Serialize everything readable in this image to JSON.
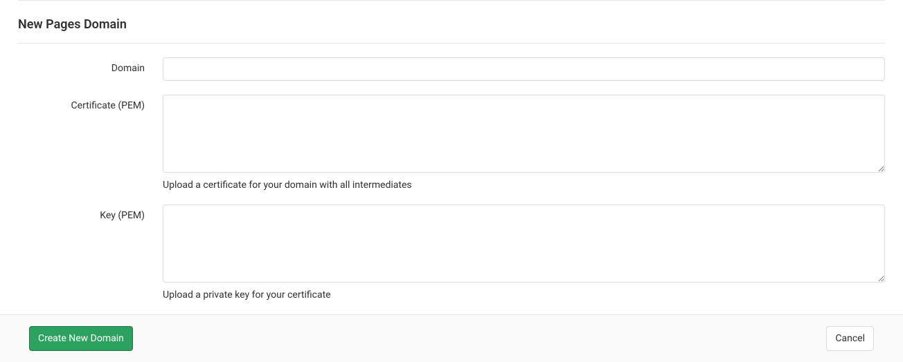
{
  "page": {
    "title": "New Pages Domain"
  },
  "form": {
    "domain": {
      "label": "Domain",
      "value": ""
    },
    "certificate": {
      "label": "Certificate (PEM)",
      "value": "",
      "help": "Upload a certificate for your domain with all intermediates"
    },
    "key": {
      "label": "Key (PEM)",
      "value": "",
      "help": "Upload a private key for your certificate"
    }
  },
  "actions": {
    "submit": "Create New Domain",
    "cancel": "Cancel"
  }
}
